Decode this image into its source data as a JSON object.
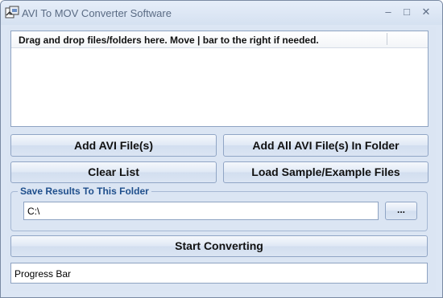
{
  "window": {
    "title": "AVI To MOV Converter Software"
  },
  "titlebar_buttons": {
    "minimize": "–",
    "maximize": "□",
    "close": "✕"
  },
  "file_list": {
    "header": "Drag and drop files/folders here. Move | bar to the right if needed."
  },
  "buttons": {
    "add_files": "Add AVI File(s)",
    "add_folder": "Add All AVI File(s) In Folder",
    "clear_list": "Clear List",
    "load_sample": "Load Sample/Example Files",
    "browse": "...",
    "start": "Start Converting"
  },
  "output": {
    "group_label": "Save Results To This Folder",
    "folder_path": "C:\\"
  },
  "progress": {
    "label": "Progress Bar"
  },
  "icons": {
    "app": "app-icon"
  }
}
